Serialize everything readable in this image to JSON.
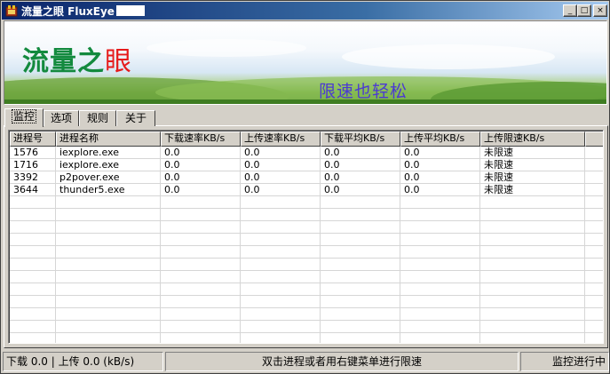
{
  "window": {
    "title": "流量之眼 FluxEye",
    "icon": "app-icon",
    "controls": {
      "minimize_glyph": "_",
      "maximize_glyph": "□",
      "close_glyph": "×"
    }
  },
  "banner": {
    "logo_green": "流量之",
    "logo_red": "眼",
    "slogan": "限速也轻松",
    "colors": {
      "logo_green": "#138a3e",
      "logo_red": "#e61b1b",
      "slogan": "#4b3ad2"
    }
  },
  "tabs": [
    {
      "label": "监控",
      "active": true
    },
    {
      "label": "选项",
      "active": false
    },
    {
      "label": "规则",
      "active": false
    },
    {
      "label": "关于",
      "active": false
    }
  ],
  "table": {
    "columns": [
      "进程号",
      "进程名称",
      "下载速率KB/s",
      "上传速率KB/s",
      "下载平均KB/s",
      "上传平均KB/s",
      "上传限速KB/s"
    ],
    "rows": [
      [
        "1576",
        "iexplore.exe",
        "0.0",
        "0.0",
        "0.0",
        "0.0",
        "未限速"
      ],
      [
        "1716",
        "iexplore.exe",
        "0.0",
        "0.0",
        "0.0",
        "0.0",
        "未限速"
      ],
      [
        "3392",
        "p2pover.exe",
        "0.0",
        "0.0",
        "0.0",
        "0.0",
        "未限速"
      ],
      [
        "3644",
        "thunder5.exe",
        "0.0",
        "0.0",
        "0.0",
        "0.0",
        "未限速"
      ]
    ]
  },
  "status_bar": {
    "speed": "下载 0.0 | 上传 0.0 (kB/s)",
    "hint": "双击进程或者用右键菜单进行限速",
    "state": "监控进行中"
  }
}
